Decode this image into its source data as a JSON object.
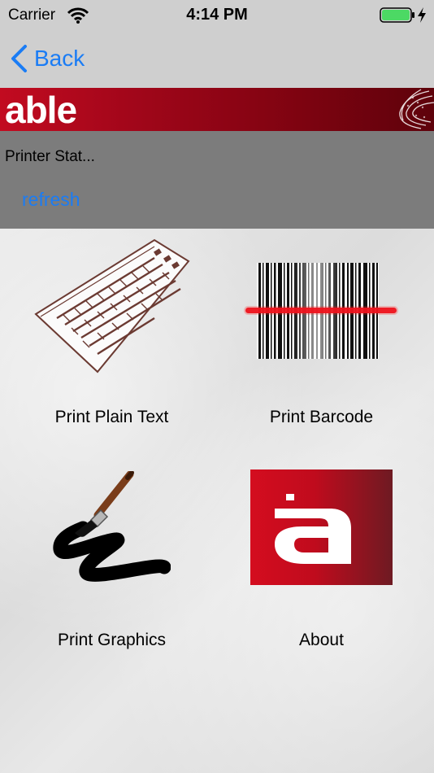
{
  "status_bar": {
    "carrier": "Carrier",
    "time": "4:14 PM"
  },
  "nav": {
    "back_label": "Back"
  },
  "brand": {
    "name": "able"
  },
  "status_panel": {
    "printer_status": "Printer Stat...",
    "refresh_label": "refresh"
  },
  "tiles": [
    {
      "label": "Print Plain Text",
      "icon": "keyboard-icon"
    },
    {
      "label": "Print Barcode",
      "icon": "barcode-scanner-icon"
    },
    {
      "label": "Print Graphics",
      "icon": "paintbrush-icon"
    },
    {
      "label": "About",
      "icon": "able-logo-icon"
    }
  ],
  "colors": {
    "accent": "#1a7cf5",
    "brand_red": "#c20b20",
    "battery": "#4cd964"
  }
}
